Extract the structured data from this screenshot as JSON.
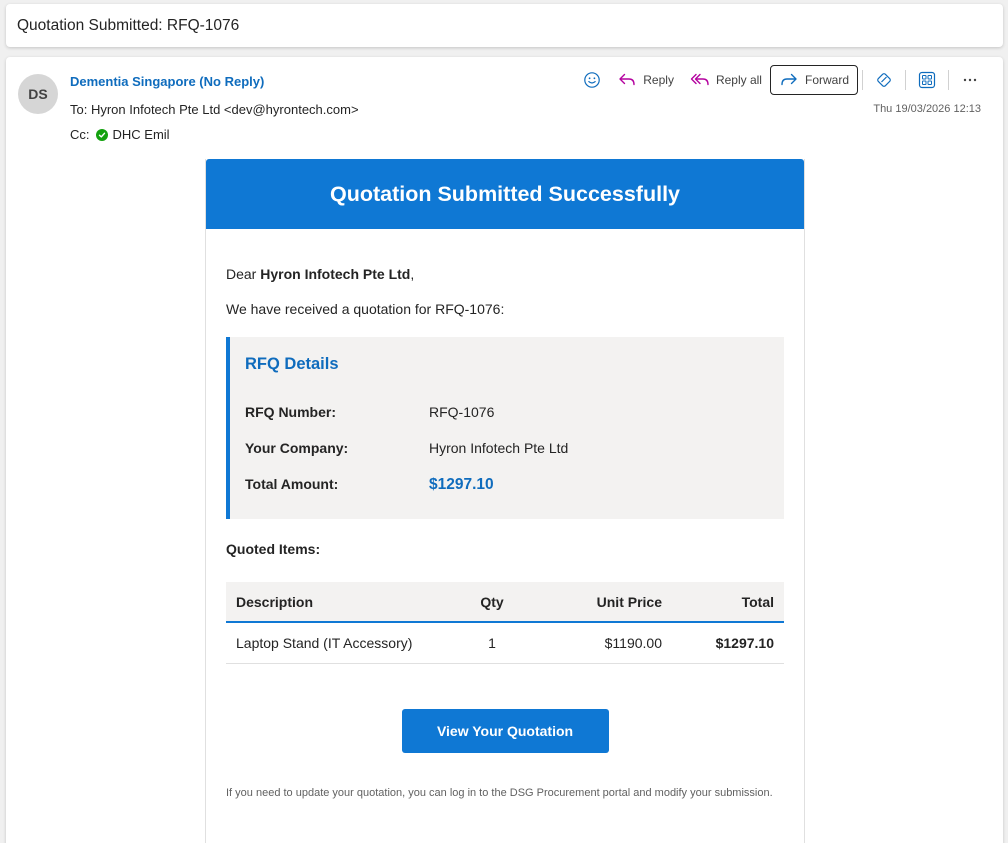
{
  "subject": "Quotation Submitted: RFQ-1076",
  "header": {
    "avatar_initials": "DS",
    "sender": "Dementia Singapore (No Reply)",
    "to_label": "To:",
    "to_value": "Hyron Infotech Pte Ltd <dev@hyrontech.com>",
    "cc_label": "Cc:",
    "cc_value": "DHC Emil",
    "date": "Thu 19/03/2026 12:13"
  },
  "toolbar": {
    "reply_label": "Reply",
    "reply_all_label": "Reply all",
    "forward_label": "Forward"
  },
  "email": {
    "hero_title": "Quotation Submitted Successfully",
    "greeting_prefix": "Dear ",
    "greeting_name": "Hyron Infotech Pte Ltd",
    "greeting_suffix": ",",
    "intro": "We have received a quotation for RFQ-1076:",
    "rfq_box": {
      "title": "RFQ Details",
      "rows": [
        {
          "label": "RFQ Number:",
          "value": "RFQ-1076"
        },
        {
          "label": "Your Company:",
          "value": "Hyron Infotech Pte Ltd"
        },
        {
          "label": "Total Amount:",
          "value": "$1297.10"
        }
      ]
    },
    "items_label": "Quoted Items:",
    "table": {
      "headers": [
        "Description",
        "Qty",
        "Unit Price",
        "Total"
      ],
      "rows": [
        [
          "Laptop Stand (IT Accessory)",
          "1",
          "$1190.00",
          "$1297.10"
        ]
      ]
    },
    "cta_label": "View Your Quotation",
    "footnote": "If you need to update your quotation, you can log in to the DSG Procurement portal and modify your submission."
  },
  "colors": {
    "brand_blue": "#0f78d4",
    "link_blue": "#0f6cbd",
    "check_green": "#13a10e"
  }
}
